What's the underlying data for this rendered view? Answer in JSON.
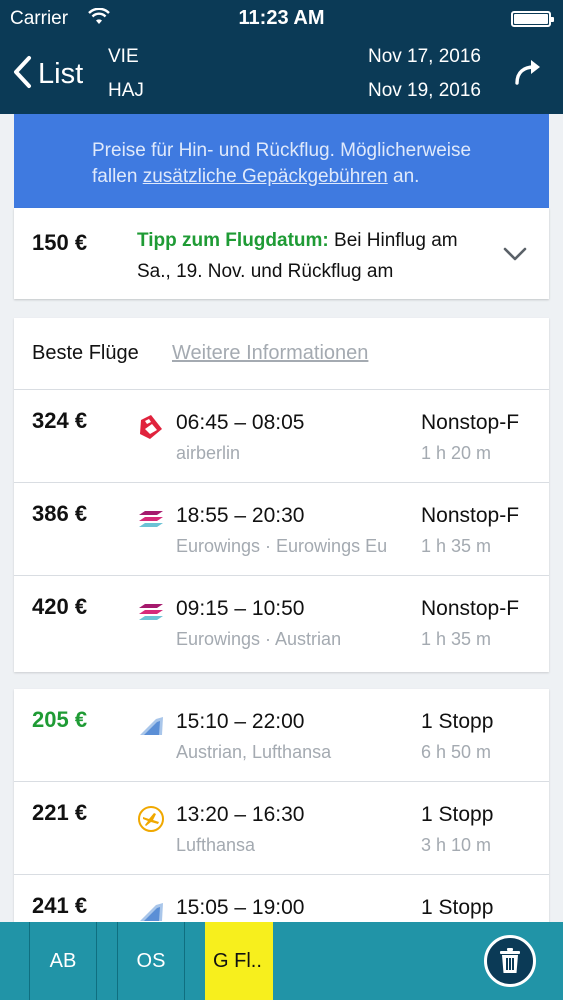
{
  "status_bar": {
    "carrier": "Carrier",
    "time": "11:23 AM"
  },
  "nav": {
    "back_label": "List",
    "from_code": "VIE",
    "to_code": "HAJ",
    "outbound_date": "Nov 17, 2016",
    "return_date": "Nov 19, 2016"
  },
  "banner": {
    "line1": "Preise für Hin- und Rückflug. Möglicherweise",
    "line2_prefix": "fallen ",
    "line2_link": "zusätzliche Gepäckgebühren",
    "line2_suffix": " an."
  },
  "tip": {
    "price": "150 €",
    "heading": "Tipp zum Flugdatum:",
    "text": " Bei Hinflug am Sa., 19. Nov. und Rückflug am"
  },
  "best_flights": {
    "title": "Beste Flüge",
    "more_info": "Weitere Informationen",
    "rows": [
      {
        "price": "324 €",
        "logo": "airberlin-logo",
        "times": "06:45 – 08:05",
        "airline": "airberlin",
        "stops": "Nonstop-F",
        "duration": "1 h 20 m"
      },
      {
        "price": "386 €",
        "logo": "eurowings-logo",
        "times": "18:55 – 20:30",
        "airline": "Eurowings · Eurowings Eu",
        "stops": "Nonstop-F",
        "duration": "1 h 35 m"
      },
      {
        "price": "420 €",
        "logo": "eurowings-logo",
        "times": "09:15 – 10:50",
        "airline": "Eurowings · Austrian",
        "stops": "Nonstop-F",
        "duration": "1 h 35 m"
      }
    ]
  },
  "other_flights": {
    "rows": [
      {
        "price": "205 €",
        "logo": "austrian-logo",
        "times": "15:10 – 22:00",
        "airline": "Austrian, Lufthansa",
        "stops": "1 Stopp",
        "duration": "6 h 50 m"
      },
      {
        "price": "221 €",
        "logo": "lufthansa-logo",
        "times": "13:20 – 16:30",
        "airline": "Lufthansa",
        "stops": "1 Stopp",
        "duration": "3 h 10 m"
      },
      {
        "price": "241 €",
        "logo": "austrian-logo",
        "times": "15:05 – 19:00",
        "airline": "",
        "stops": "1 Stopp",
        "duration": ""
      }
    ]
  },
  "filters": [
    {
      "label": "AB"
    },
    {
      "label": "OS"
    },
    {
      "label": "G Fl.."
    }
  ],
  "colors": {
    "navy": "#0b3a56",
    "banner_blue": "#3f7ae0",
    "tip_green": "#1f9b35",
    "bar_teal": "#2194a7",
    "filter_active": "#f7ef1d"
  }
}
